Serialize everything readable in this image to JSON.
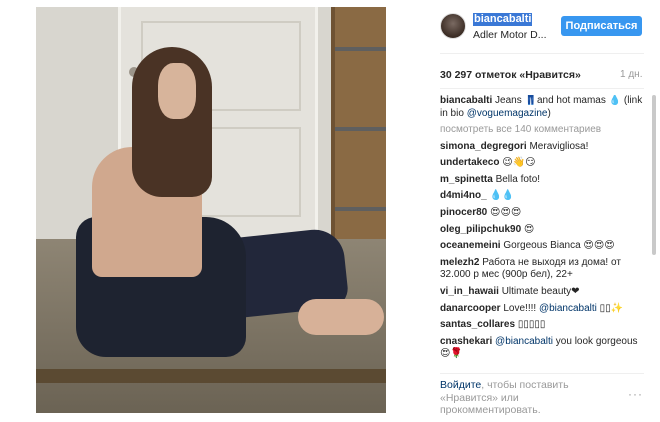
{
  "post": {
    "username": "biancabalti",
    "location": "Adler Motor D...",
    "follow_label": "Подписаться",
    "likes": "30 297 отметок «Нравится»",
    "time": "1 дн."
  },
  "caption": {
    "user": "biancabalti",
    "text_before": " Jeans 👖and hot mamas 💧 (link in bio ",
    "mention": "@voguemagazine",
    "text_after": ")"
  },
  "view_all": "посмотреть все 140 комментариев",
  "comments": [
    {
      "user": "simona_degregori",
      "text": " Meravigliosa!",
      "mention": ""
    },
    {
      "user": "undertakeco",
      "text": " 😉👋😏",
      "mention": ""
    },
    {
      "user": "m_spinetta",
      "text": " Bella foto!",
      "mention": ""
    },
    {
      "user": "d4mi4no_",
      "text": " 💧💧",
      "mention": ""
    },
    {
      "user": "pinocer80",
      "text": " 😍😍😍",
      "mention": ""
    },
    {
      "user": "oleg_pilipchuk90",
      "text": " 😍",
      "mention": ""
    },
    {
      "user": "oceanemeini",
      "text": " Gorgeous Bianca 😍😍😍",
      "mention": ""
    },
    {
      "user": "melezh2",
      "text": " Работа не выходя из дома! от 32.000 р мес (900р бел), 22+",
      "mention": ""
    },
    {
      "user": "vi_in_hawaii",
      "text": " Ultimate beauty❤",
      "mention": ""
    },
    {
      "user": "danarcooper",
      "text": " Love!!!! ",
      "mention": "@biancabalti",
      "after": " ▯▯✨"
    },
    {
      "user": "santas_collares",
      "text": " ▯▯▯▯▯",
      "mention": ""
    },
    {
      "user": "cnashekari",
      "text": " ",
      "mention": "@biancabalti",
      "after": " you look gorgeous 😍🌹"
    }
  ],
  "footer": {
    "login_link": "Войдите",
    "login_rest": ", чтобы поставить «Нравится» или прокомментировать.",
    "more": "···"
  }
}
